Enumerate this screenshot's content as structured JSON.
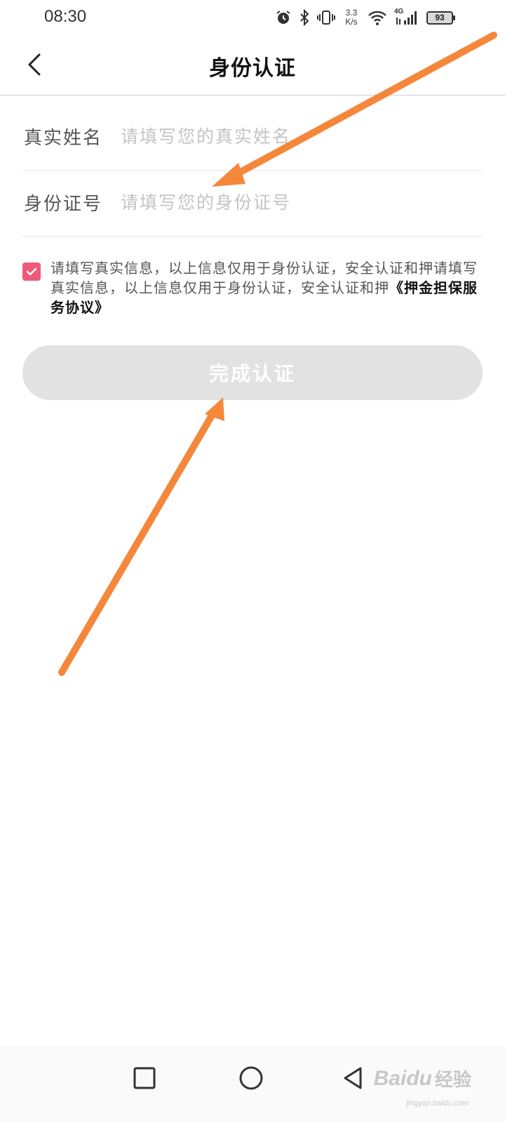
{
  "status_bar": {
    "time": "08:30",
    "net_speed_value": "3.3",
    "net_speed_unit": "K/s",
    "network_type": "4G",
    "battery": "93",
    "icons": [
      "alarm-icon",
      "bluetooth-icon",
      "vibrate-icon",
      "wifi-icon",
      "signal-icon",
      "battery-icon"
    ]
  },
  "header": {
    "title": "身份认证",
    "back_icon": "chevron-left-icon"
  },
  "form": {
    "name": {
      "label": "真实姓名",
      "value": "",
      "placeholder": "请填写您的真实姓名"
    },
    "id_number": {
      "label": "身份证号",
      "value": "",
      "placeholder": "请填写您的身份证号"
    }
  },
  "agreement": {
    "checked": true,
    "text": "请填写真实信息，以上信息仅用于身份认证，安全认证和押请填写真实信息，以上信息仅用于身份认证，安全认证和押",
    "link": "《押金担保服务协议》"
  },
  "submit": {
    "label": "完成认证",
    "enabled": false
  },
  "nav_bar": {
    "icons": [
      "square-icon",
      "circle-icon",
      "triangle-back-icon"
    ]
  },
  "watermark": {
    "brand": "Baidu",
    "cn": "经验",
    "url": "jingyan.baidu.com"
  },
  "colors": {
    "accent": "#ef5a79",
    "annotation_arrow": "#f5873b",
    "button_disabled": "#e2e2e2"
  }
}
